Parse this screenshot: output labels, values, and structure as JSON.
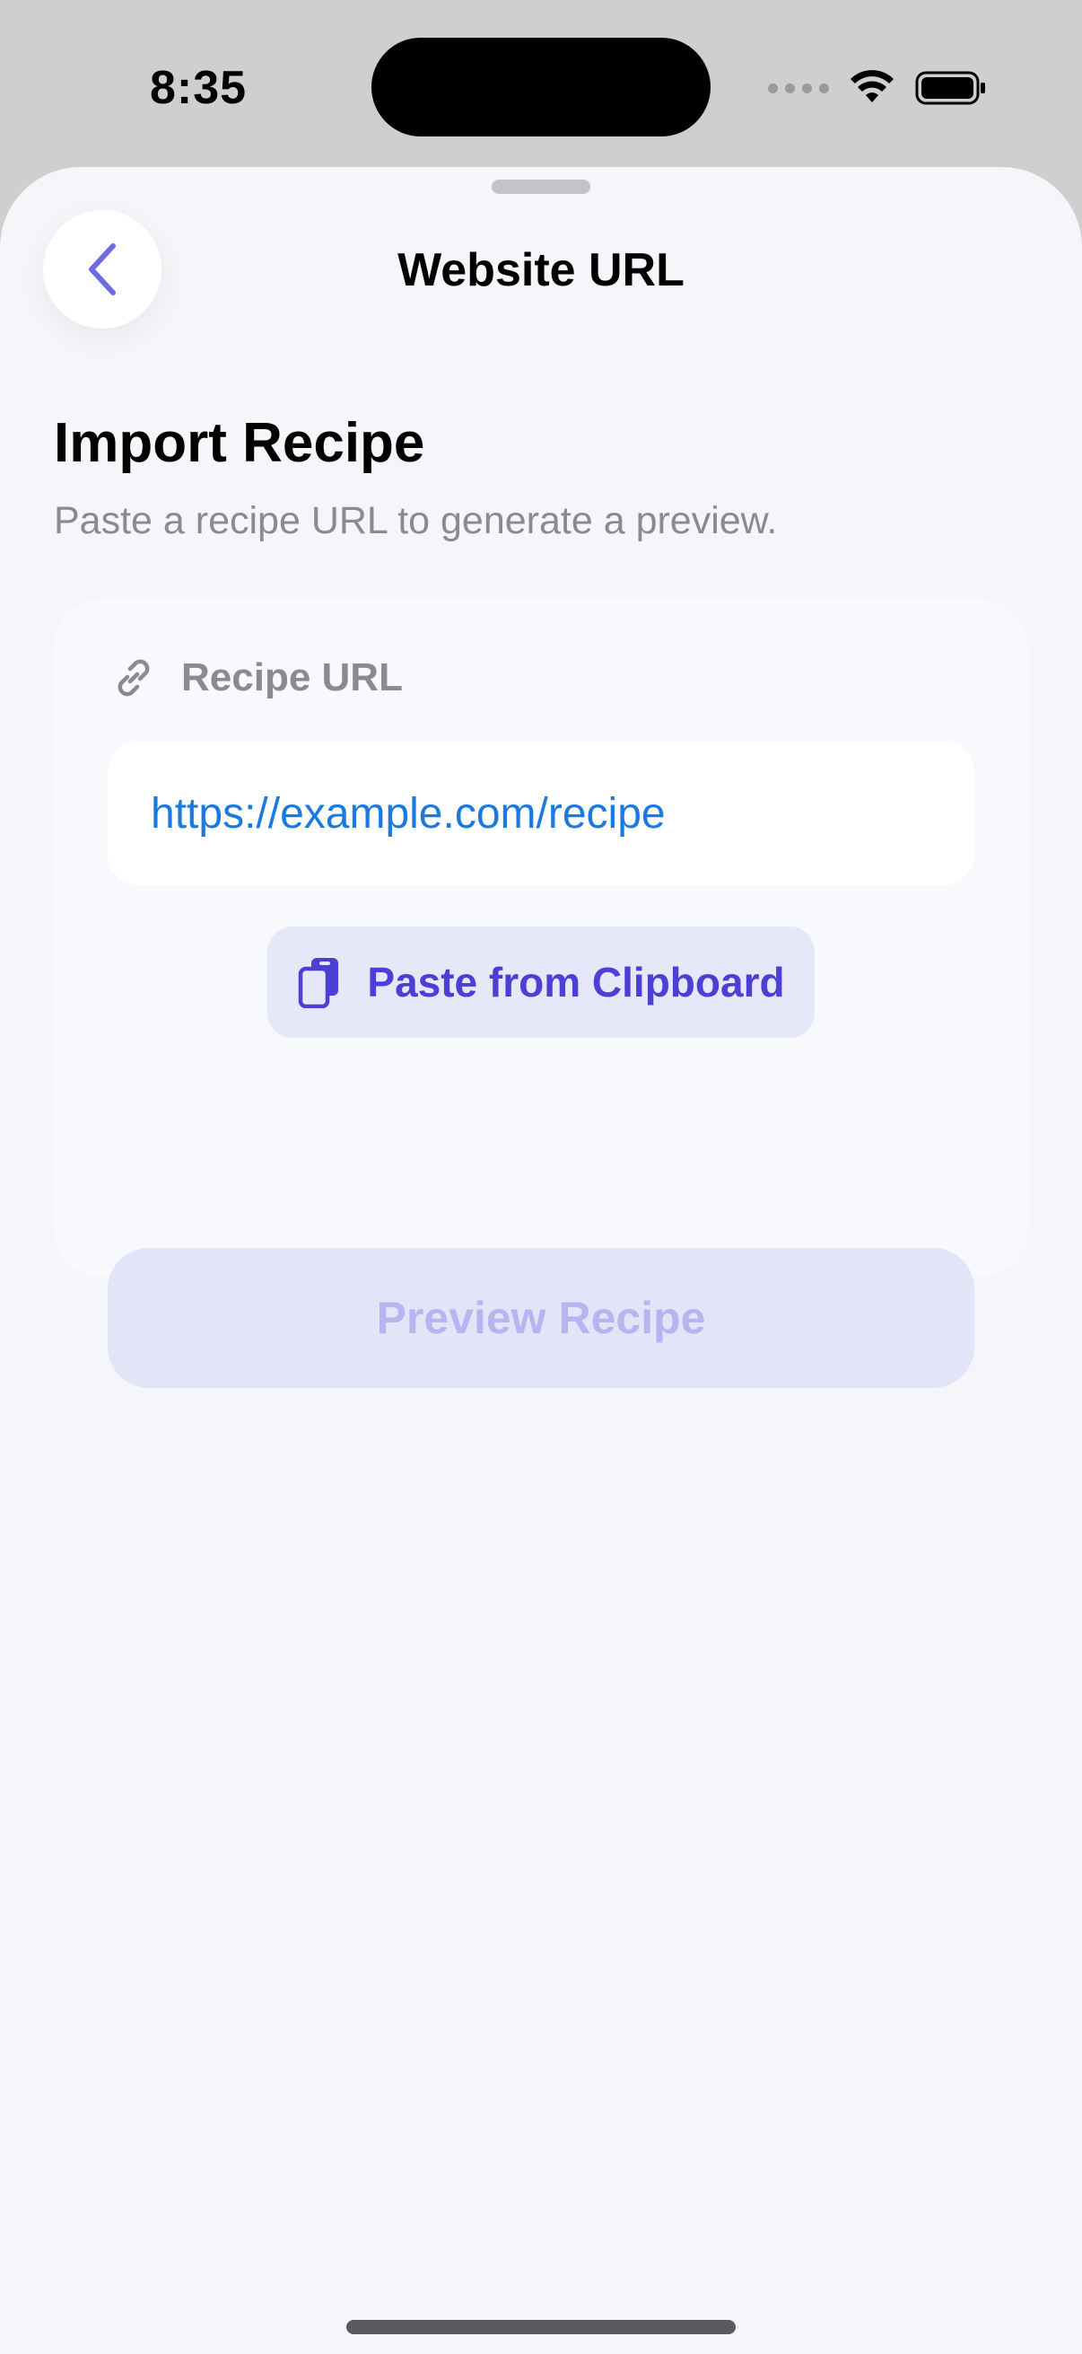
{
  "status_bar": {
    "time": "8:35"
  },
  "nav": {
    "title": "Website URL",
    "back_icon": "chevron-left-icon"
  },
  "header": {
    "title": "Import Recipe",
    "subtitle": "Paste a recipe URL to generate a preview."
  },
  "form": {
    "url_label": "Recipe URL",
    "url_label_icon": "link-icon",
    "url_value": "https://example.com/recipe",
    "paste_button_label": "Paste from Clipboard",
    "paste_button_icon": "clipboard-icon",
    "preview_button_label": "Preview Recipe",
    "preview_enabled": false
  },
  "colors": {
    "accent": "#4b3fd6",
    "link": "#1a7ae0",
    "disabled_text": "#b8b4f0",
    "background": "#f5f6fa"
  }
}
